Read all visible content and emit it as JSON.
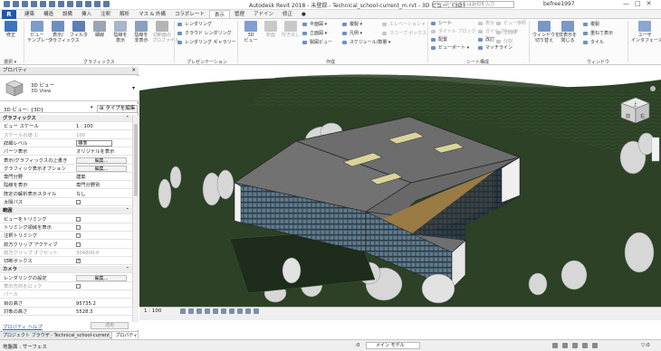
{
  "title_bar": {
    "app_title": "Autodesk Revit 2018 - 未登録 -   Technical_school-current_m.rvt - 3D ビュー: {3D}",
    "search_placeholder": "キーワードまたは語句を入力",
    "username": "befree1997",
    "minimize": "—",
    "restore": "□",
    "close": "✕"
  },
  "app_button": "R",
  "tabs": [
    "建築",
    "構造",
    "設備",
    "挿入",
    "注釈",
    "解析",
    "マス & 外構",
    "コラボレート",
    "表示",
    "管理",
    "アドイン",
    "修正",
    "●"
  ],
  "active_tab": "表示",
  "ribbon": {
    "modify": "修正",
    "select": "選択 ▾",
    "graphics_buttons": [
      {
        "id": "view-template",
        "label": "ビュー\nテンプレート"
      },
      {
        "id": "visibility",
        "label": "表示/\nグラフィックス"
      },
      {
        "id": "filter",
        "label": "フィルタ"
      },
      {
        "id": "thin-lines",
        "label": "細線"
      },
      {
        "id": "show-hidden",
        "label": "陰線を\n表示"
      },
      {
        "id": "remove-hidden",
        "label": "陰線を\n非表示"
      },
      {
        "id": "cut-profile",
        "label": "切断面の\nプロファイル"
      }
    ],
    "graphics_label": "グラフィックス",
    "render_items": [
      "レンダリング",
      "クラウド レンダリング",
      "レンダリング ギャラリー"
    ],
    "presentation_label": "プレゼンテーション",
    "create_big": [
      {
        "id": "3d-view",
        "label": "3D\nビュー"
      },
      {
        "id": "section",
        "label": "断面"
      },
      {
        "id": "callout",
        "label": "吹き出し"
      }
    ],
    "create_small": [
      "平面図 ▾",
      "立面図 ▾",
      "製図ビュー",
      "複製 ▾",
      "凡例 ▾",
      "スケジュール/数量 ▾",
      "エレベーション ▾",
      "スコープ ボックス"
    ],
    "create_label": "作成",
    "sheet_items": [
      "シート",
      "タイトル ブロック",
      "配置",
      "ビューポート ▾",
      "表示",
      "ガイド グリッド",
      "改訂",
      "マッチライン"
    ],
    "sheet_label": "シート構成",
    "sheet_dis": [
      "ビュー参照",
      "全面線",
      "分割"
    ],
    "window_big": [
      {
        "id": "switch-window",
        "label": "ウィンドウを\n切り替え"
      },
      {
        "id": "close-inactive",
        "label": "非表示を\n閉じる"
      }
    ],
    "window_small": [
      "複製",
      "重ねて表示",
      "タイル"
    ],
    "window_label": "ウィンドウ",
    "ui_label": "ユーザ\nインタフェース"
  },
  "properties": {
    "header": "プロパティ",
    "close": "✕",
    "type_name": "3D ビュー",
    "type_sub": "3D View",
    "selector_value": "3D ビュー: {3D}",
    "edit_type": "タイプを編集",
    "rows": [
      {
        "kind": "group",
        "label": "グラフィックス"
      },
      {
        "kind": "text",
        "label": "ビュー スケール",
        "value": "1 : 100"
      },
      {
        "kind": "text",
        "label": "スケールの値   1:",
        "value": "100",
        "dis": true
      },
      {
        "kind": "edit",
        "label": "詳細レベル",
        "value": "標準"
      },
      {
        "kind": "text",
        "label": "パーツ表示",
        "value": "オリジナルを表示"
      },
      {
        "kind": "button",
        "label": "表示/グラフィックスの上書き",
        "value": "編集..."
      },
      {
        "kind": "button",
        "label": "グラフィック表示オプション",
        "value": "編集..."
      },
      {
        "kind": "text",
        "label": "専門分野",
        "value": "建築"
      },
      {
        "kind": "text",
        "label": "陰線を表示",
        "value": "専門分野別"
      },
      {
        "kind": "text",
        "label": "既定の解析表示スタイル",
        "value": "なし"
      },
      {
        "kind": "check",
        "label": "太陽パス",
        "value": false
      },
      {
        "kind": "group",
        "label": "範囲"
      },
      {
        "kind": "check",
        "label": "ビューをトリミング",
        "value": false
      },
      {
        "kind": "check",
        "label": "トリミング領域を表示",
        "value": false
      },
      {
        "kind": "check",
        "label": "注釈トリミング",
        "value": false
      },
      {
        "kind": "check",
        "label": "前方クリップ アクティブ",
        "value": false
      },
      {
        "kind": "text",
        "label": "前方クリップ オフセット",
        "value": "304800.0",
        "dis": true
      },
      {
        "kind": "check",
        "label": "切断ボックス",
        "value": true
      },
      {
        "kind": "group",
        "label": "カメラ"
      },
      {
        "kind": "button",
        "label": "レンダリングの設定",
        "value": "編集..."
      },
      {
        "kind": "check",
        "label": "表示方向をロック",
        "value": false,
        "dis": true
      },
      {
        "kind": "text",
        "label": "パース",
        "value": "",
        "dis": true
      },
      {
        "kind": "text",
        "label": "目の高さ",
        "value": "95735.2"
      },
      {
        "kind": "text",
        "label": "対象の高さ",
        "value": "5528.3"
      }
    ],
    "help_link": "プロパティ ヘルプ",
    "apply": "適用"
  },
  "panel_tabs": [
    "プロジェクト ブラウザ - Technical_school-current_m.rvt",
    "プロパティ"
  ],
  "view": {
    "scale": "1 : 100",
    "viewcube_top": "上",
    "viewcube_front": "前",
    "viewcube_right": "右"
  },
  "status": {
    "text": "地盤面 : サーフェス",
    "zero": ":0",
    "model": "メイン モデル",
    "filter": "▽:0"
  },
  "colors": {
    "grass": "#2c4126",
    "roof": "#6d6d6d",
    "glass": "#3c5060",
    "accent": "#1e5aa8"
  }
}
